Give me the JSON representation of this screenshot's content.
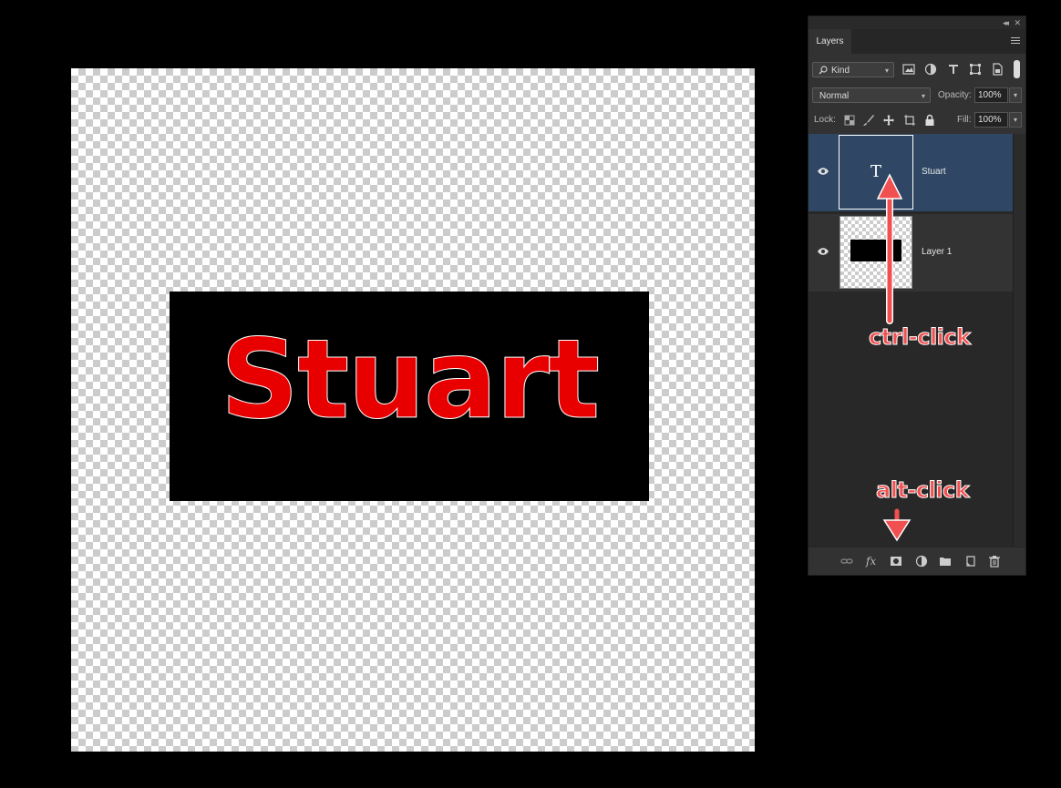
{
  "canvas": {
    "text": "Stuart",
    "text_color": "#e80000",
    "rect_color": "#000000"
  },
  "panel": {
    "tab_label": "Layers",
    "filter": {
      "label": "Kind",
      "icons": [
        "image-filter-icon",
        "adjustment-filter-icon",
        "type-filter-icon",
        "shape-filter-icon",
        "smart-object-filter-icon"
      ]
    },
    "blend_mode": "Normal",
    "opacity_label": "Opacity:",
    "opacity_value": "100%",
    "lock_label": "Lock:",
    "lock_icons": [
      "lock-transparent-icon",
      "lock-image-icon",
      "lock-position-icon",
      "lock-artboard-icon",
      "lock-all-icon"
    ],
    "fill_label": "Fill:",
    "fill_value": "100%",
    "layers": [
      {
        "name": "Stuart",
        "type": "text",
        "thumb_glyph": "T",
        "selected": true,
        "visible": true
      },
      {
        "name": "Layer 1",
        "type": "pixel",
        "selected": false,
        "visible": true
      }
    ],
    "bottom_icons": [
      "link-layers-icon",
      "fx-icon",
      "add-mask-icon",
      "adjustment-layer-icon",
      "new-group-icon",
      "new-layer-icon",
      "delete-icon"
    ],
    "fx_glyph": "fx"
  },
  "annotations": {
    "ctrl_click": "ctrl-click",
    "alt_click": "alt-click",
    "color": "#f05050"
  }
}
